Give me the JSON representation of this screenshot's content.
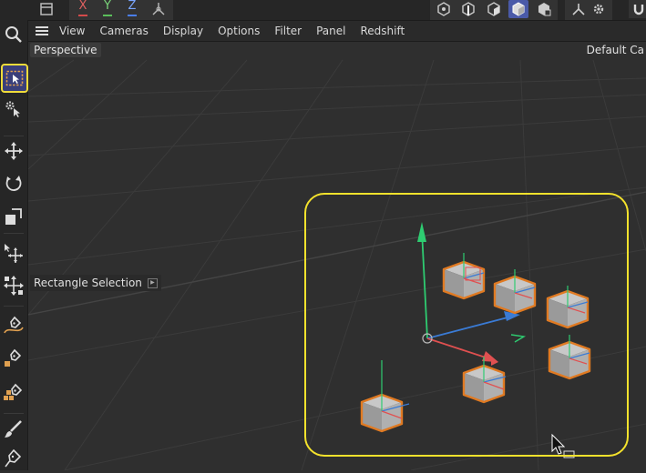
{
  "top_toolbar": {
    "axis_x": "X",
    "axis_y": "Y",
    "axis_z": "Z"
  },
  "viewport_menu": {
    "items": [
      "View",
      "Cameras",
      "Display",
      "Options",
      "Filter",
      "Panel",
      "Redshift"
    ]
  },
  "viewport": {
    "view_name": "Perspective",
    "camera_name": "Default Ca",
    "tooltip": "Rectangle Selection"
  },
  "colors": {
    "selection": "#f4e22c",
    "object_highlight": "#e07a22",
    "active_tool_bg": "#3a3f7a",
    "axis_x": "#d44a4a",
    "axis_y": "#5bbf5b",
    "axis_z": "#4a7ff0"
  },
  "icons": {
    "tools": [
      "search-icon",
      "rectangle-selection-icon",
      "live-selection-icon",
      "move-icon",
      "rotate-icon",
      "scale-icon",
      "move-component-icon",
      "transform-icon",
      "pen-spline-icon",
      "sketch-pen-icon",
      "pen-object-icon",
      "brush-icon",
      "pen-icon"
    ]
  }
}
